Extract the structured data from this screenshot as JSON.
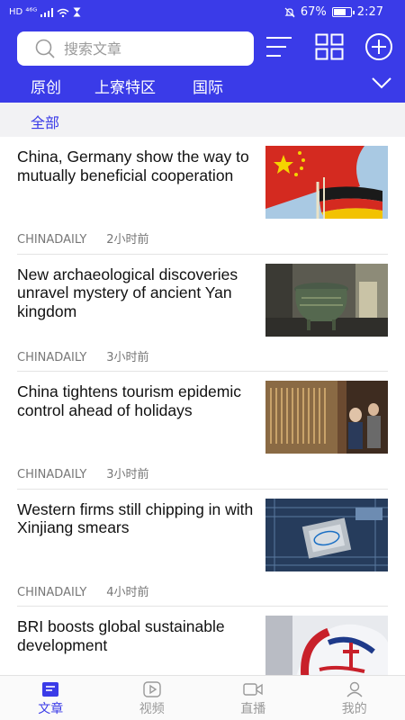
{
  "status_bar": {
    "network": "HD ⁴⁶ᴳ",
    "battery_percent": "67%",
    "time": "2:27",
    "battery_level": 0.67
  },
  "search": {
    "placeholder": "搜索文章"
  },
  "tabs": [
    {
      "label": "原创",
      "active": false
    },
    {
      "label": "上寮特区",
      "active": false
    },
    {
      "label": "国际",
      "active": true
    }
  ],
  "filter": {
    "label": "全部"
  },
  "articles": [
    {
      "title": "China, Germany show the way to mutually beneficial cooperation",
      "source": "CHINADAILY",
      "time": "2小时前",
      "thumb": "china-germany-flags"
    },
    {
      "title": "New archaeological discoveries unravel mystery of ancient Yan kingdom",
      "source": "CHINADAILY",
      "time": "3小时前",
      "thumb": "bronze-vessel"
    },
    {
      "title": "China tightens tourism epidemic control ahead of holidays",
      "source": "CHINADAILY",
      "time": "3小时前",
      "thumb": "museum-visitors"
    },
    {
      "title": "Western firms still chipping in with Xinjiang smears",
      "source": "CHINADAILY",
      "time": "4小时前",
      "thumb": "intel-chip"
    },
    {
      "title": "BRI boosts global sustainable development",
      "source": "",
      "time": "",
      "thumb": "belt-and-road-logo"
    }
  ],
  "bottom_nav": [
    {
      "label": "文章",
      "icon": "article-icon",
      "active": true
    },
    {
      "label": "视频",
      "icon": "video-icon",
      "active": false
    },
    {
      "label": "直播",
      "icon": "live-icon",
      "active": false
    },
    {
      "label": "我的",
      "icon": "profile-icon",
      "active": false
    }
  ],
  "colors": {
    "brand": "#3a3be8",
    "text": "#111111",
    "meta": "#777777"
  }
}
